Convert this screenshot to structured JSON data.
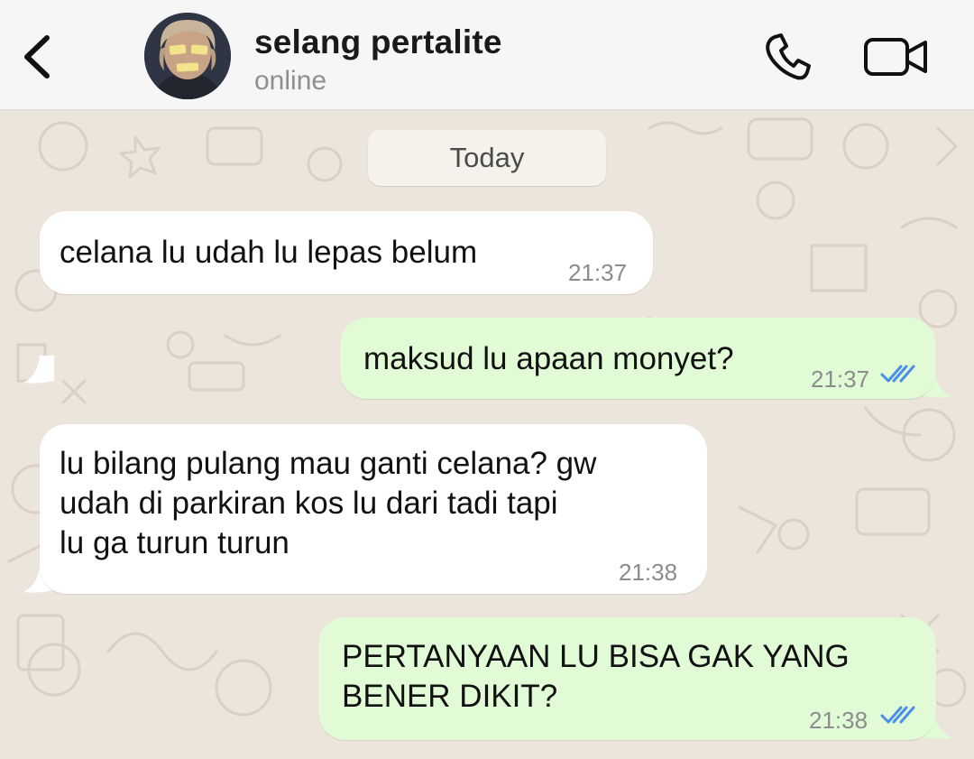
{
  "header": {
    "contact_name": "selang pertalite",
    "status": "online"
  },
  "date_divider": "Today",
  "messages": [
    {
      "direction": "incoming",
      "text": "celana lu udah lu lepas belum",
      "time": "21:37"
    },
    {
      "direction": "outgoing",
      "text": "maksud lu apaan monyet?",
      "time": "21:37",
      "status": "read"
    },
    {
      "direction": "incoming",
      "text": "lu bilang pulang mau ganti celana? gw\nudah di parkiran kos lu dari tadi tapi\nlu ga turun turun",
      "time": "21:38"
    },
    {
      "direction": "outgoing",
      "text": "PERTANYAAN LU BISA GAK YANG\nBENER DIKIT?",
      "time": "21:38",
      "status": "read"
    }
  ],
  "icons": {
    "back": "chevron-left-icon",
    "call": "phone-icon",
    "video": "video-camera-icon",
    "read_receipt": "double-check-icon"
  },
  "colors": {
    "incoming_bubble": "#ffffff",
    "outgoing_bubble": "#e2fbd7",
    "read_tick": "#4a8fe7",
    "chat_background": "#ece5dc",
    "header_background": "#f6f6f6"
  }
}
